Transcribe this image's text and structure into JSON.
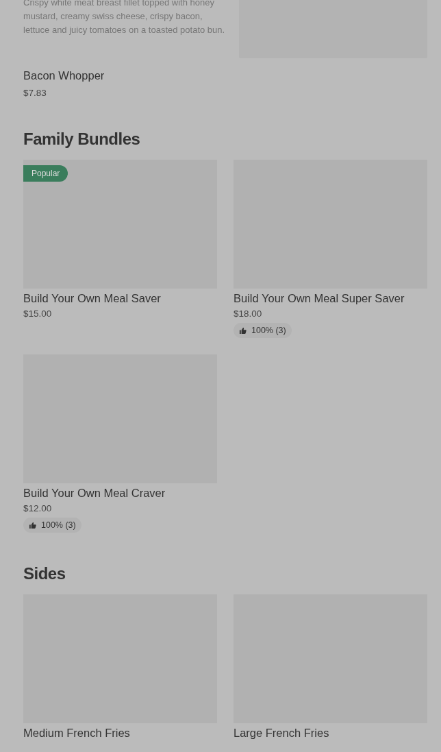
{
  "partial_item": {
    "description": "Crispy white meat breast fillet topped with honey mustard, creamy swiss cheese, crispy bacon, lettuce and juicy tomatoes on a toasted potato bun."
  },
  "item": {
    "name": "Bacon Whopper",
    "price": "$7.83"
  },
  "sections": [
    {
      "title": "Family Bundles",
      "items": [
        {
          "name": "Build Your Own Meal Saver",
          "price": "$15.00",
          "badge": "Popular"
        },
        {
          "name": "Build Your Own Meal Super Saver",
          "price": "$18.00",
          "rating": "100% (3)"
        },
        {
          "name": "Build Your Own Meal Craver",
          "price": "$12.00",
          "rating": "100% (3)"
        }
      ]
    },
    {
      "title": "Sides",
      "items": [
        {
          "name": "Medium French Fries"
        },
        {
          "name": "Large French Fries"
        }
      ]
    }
  ]
}
